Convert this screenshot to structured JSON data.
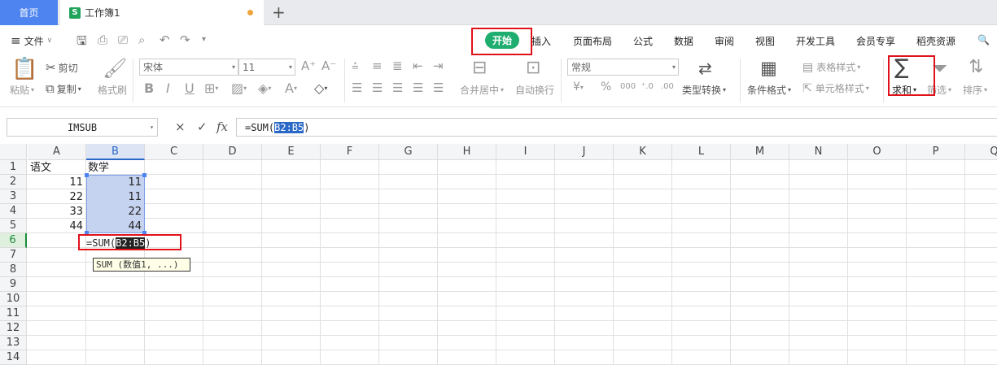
{
  "tabs": {
    "home": "首页",
    "doc_icon": "S",
    "doc": "工作簿1",
    "new_tab": "+"
  },
  "menubar": {
    "file": "文件",
    "items": [
      "开始",
      "插入",
      "页面布局",
      "公式",
      "数据",
      "审阅",
      "视图",
      "开发工具",
      "会员专享",
      "稻壳资源"
    ],
    "search_icon": "🔍"
  },
  "ribbon": {
    "paste": "粘贴",
    "cut": "剪切",
    "copy": "复制",
    "format_painter": "格式刷",
    "font": "宋体",
    "font_size": "11",
    "font_grow": "A⁺",
    "font_shrink": "A⁻",
    "bold": "B",
    "italic": "I",
    "underline": "U",
    "merge_center": "合并居中",
    "wrap_text": "自动换行",
    "number_format": "常规",
    "currency": "¥",
    "percent": "%",
    "thousands": "000",
    "dec_inc": "⁺.0",
    "dec_dec": ".00",
    "type_convert": "类型转换",
    "cond_format": "条件格式",
    "table_style": "表格样式",
    "cell_style": "单元格样式",
    "sum_symbol": "∑",
    "sum": "求和",
    "filter": "筛选",
    "sort": "排序"
  },
  "formula_bar": {
    "name_box": "IMSUB",
    "cancel": "×",
    "confirm": "✓",
    "fx": "fx",
    "prefix": "=SUM(",
    "range": "B2:B5",
    "suffix": ")"
  },
  "columns": [
    "A",
    "B",
    "C",
    "D",
    "E",
    "F",
    "G",
    "H",
    "I",
    "J",
    "K",
    "L",
    "M",
    "N",
    "O",
    "P",
    "Q"
  ],
  "rows": [
    "1",
    "2",
    "3",
    "4",
    "5",
    "6",
    "7",
    "8",
    "9",
    "10",
    "11",
    "12",
    "13",
    "14"
  ],
  "cells": {
    "A1": "语文",
    "B1": "数学",
    "A2": "11",
    "B2": "11",
    "A3": "22",
    "B3": "11",
    "A4": "33",
    "B4": "22",
    "A5": "44",
    "B5": "44"
  },
  "editing": {
    "prefix": "=SUM(",
    "range": "B2:B5",
    "suffix": ")"
  },
  "tooltip": "SUM (数值1, ...)",
  "colors": {
    "accent": "#4d84f0",
    "start_tab": "#1fae70",
    "highlight_box": "#e0111b",
    "selection": "#c6d3f0"
  }
}
